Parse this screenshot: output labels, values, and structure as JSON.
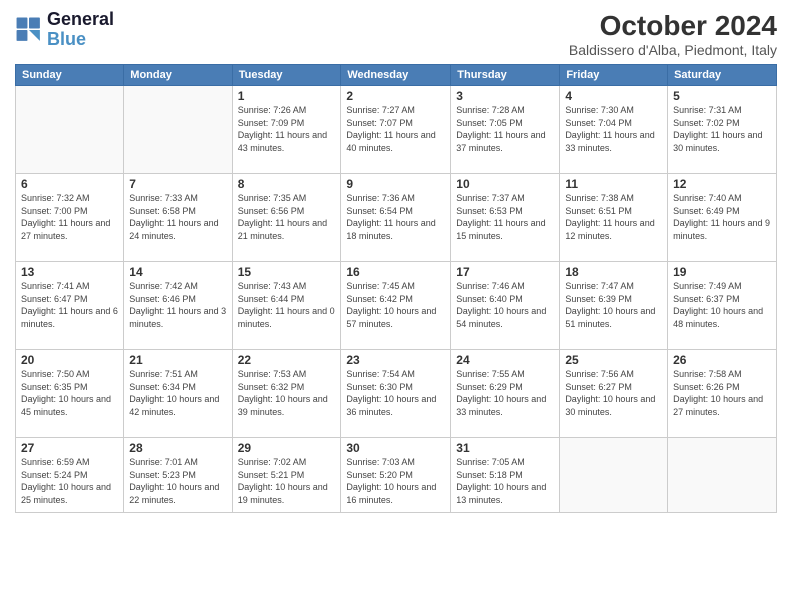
{
  "header": {
    "logo_general": "General",
    "logo_blue": "Blue",
    "month_title": "October 2024",
    "location": "Baldissero d'Alba, Piedmont, Italy"
  },
  "days_of_week": [
    "Sunday",
    "Monday",
    "Tuesday",
    "Wednesday",
    "Thursday",
    "Friday",
    "Saturday"
  ],
  "weeks": [
    [
      {
        "day": "",
        "info": ""
      },
      {
        "day": "",
        "info": ""
      },
      {
        "day": "1",
        "sunrise": "7:26 AM",
        "sunset": "7:09 PM",
        "daylight": "11 hours and 43 minutes."
      },
      {
        "day": "2",
        "sunrise": "7:27 AM",
        "sunset": "7:07 PM",
        "daylight": "11 hours and 40 minutes."
      },
      {
        "day": "3",
        "sunrise": "7:28 AM",
        "sunset": "7:05 PM",
        "daylight": "11 hours and 37 minutes."
      },
      {
        "day": "4",
        "sunrise": "7:30 AM",
        "sunset": "7:04 PM",
        "daylight": "11 hours and 33 minutes."
      },
      {
        "day": "5",
        "sunrise": "7:31 AM",
        "sunset": "7:02 PM",
        "daylight": "11 hours and 30 minutes."
      }
    ],
    [
      {
        "day": "6",
        "sunrise": "7:32 AM",
        "sunset": "7:00 PM",
        "daylight": "11 hours and 27 minutes."
      },
      {
        "day": "7",
        "sunrise": "7:33 AM",
        "sunset": "6:58 PM",
        "daylight": "11 hours and 24 minutes."
      },
      {
        "day": "8",
        "sunrise": "7:35 AM",
        "sunset": "6:56 PM",
        "daylight": "11 hours and 21 minutes."
      },
      {
        "day": "9",
        "sunrise": "7:36 AM",
        "sunset": "6:54 PM",
        "daylight": "11 hours and 18 minutes."
      },
      {
        "day": "10",
        "sunrise": "7:37 AM",
        "sunset": "6:53 PM",
        "daylight": "11 hours and 15 minutes."
      },
      {
        "day": "11",
        "sunrise": "7:38 AM",
        "sunset": "6:51 PM",
        "daylight": "11 hours and 12 minutes."
      },
      {
        "day": "12",
        "sunrise": "7:40 AM",
        "sunset": "6:49 PM",
        "daylight": "11 hours and 9 minutes."
      }
    ],
    [
      {
        "day": "13",
        "sunrise": "7:41 AM",
        "sunset": "6:47 PM",
        "daylight": "11 hours and 6 minutes."
      },
      {
        "day": "14",
        "sunrise": "7:42 AM",
        "sunset": "6:46 PM",
        "daylight": "11 hours and 3 minutes."
      },
      {
        "day": "15",
        "sunrise": "7:43 AM",
        "sunset": "6:44 PM",
        "daylight": "11 hours and 0 minutes."
      },
      {
        "day": "16",
        "sunrise": "7:45 AM",
        "sunset": "6:42 PM",
        "daylight": "10 hours and 57 minutes."
      },
      {
        "day": "17",
        "sunrise": "7:46 AM",
        "sunset": "6:40 PM",
        "daylight": "10 hours and 54 minutes."
      },
      {
        "day": "18",
        "sunrise": "7:47 AM",
        "sunset": "6:39 PM",
        "daylight": "10 hours and 51 minutes."
      },
      {
        "day": "19",
        "sunrise": "7:49 AM",
        "sunset": "6:37 PM",
        "daylight": "10 hours and 48 minutes."
      }
    ],
    [
      {
        "day": "20",
        "sunrise": "7:50 AM",
        "sunset": "6:35 PM",
        "daylight": "10 hours and 45 minutes."
      },
      {
        "day": "21",
        "sunrise": "7:51 AM",
        "sunset": "6:34 PM",
        "daylight": "10 hours and 42 minutes."
      },
      {
        "day": "22",
        "sunrise": "7:53 AM",
        "sunset": "6:32 PM",
        "daylight": "10 hours and 39 minutes."
      },
      {
        "day": "23",
        "sunrise": "7:54 AM",
        "sunset": "6:30 PM",
        "daylight": "10 hours and 36 minutes."
      },
      {
        "day": "24",
        "sunrise": "7:55 AM",
        "sunset": "6:29 PM",
        "daylight": "10 hours and 33 minutes."
      },
      {
        "day": "25",
        "sunrise": "7:56 AM",
        "sunset": "6:27 PM",
        "daylight": "10 hours and 30 minutes."
      },
      {
        "day": "26",
        "sunrise": "7:58 AM",
        "sunset": "6:26 PM",
        "daylight": "10 hours and 27 minutes."
      }
    ],
    [
      {
        "day": "27",
        "sunrise": "6:59 AM",
        "sunset": "5:24 PM",
        "daylight": "10 hours and 25 minutes."
      },
      {
        "day": "28",
        "sunrise": "7:01 AM",
        "sunset": "5:23 PM",
        "daylight": "10 hours and 22 minutes."
      },
      {
        "day": "29",
        "sunrise": "7:02 AM",
        "sunset": "5:21 PM",
        "daylight": "10 hours and 19 minutes."
      },
      {
        "day": "30",
        "sunrise": "7:03 AM",
        "sunset": "5:20 PM",
        "daylight": "10 hours and 16 minutes."
      },
      {
        "day": "31",
        "sunrise": "7:05 AM",
        "sunset": "5:18 PM",
        "daylight": "10 hours and 13 minutes."
      },
      {
        "day": "",
        "info": ""
      },
      {
        "day": "",
        "info": ""
      }
    ]
  ]
}
